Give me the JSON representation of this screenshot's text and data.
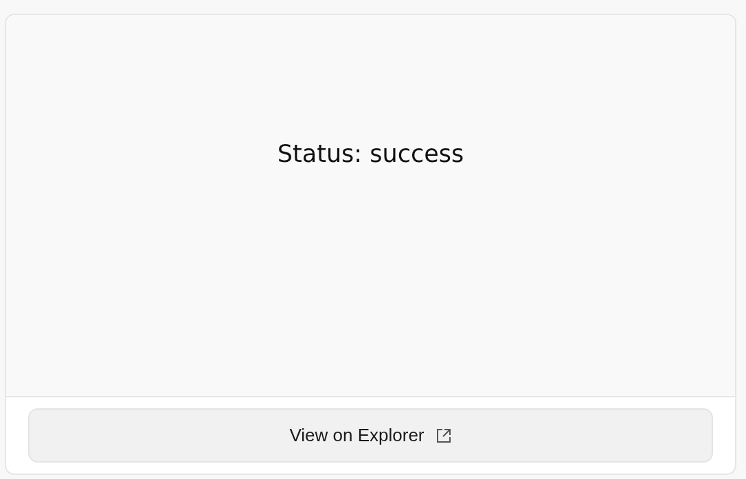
{
  "status": {
    "text": "Status: success"
  },
  "footer": {
    "button": {
      "label": "View on Explorer"
    }
  }
}
